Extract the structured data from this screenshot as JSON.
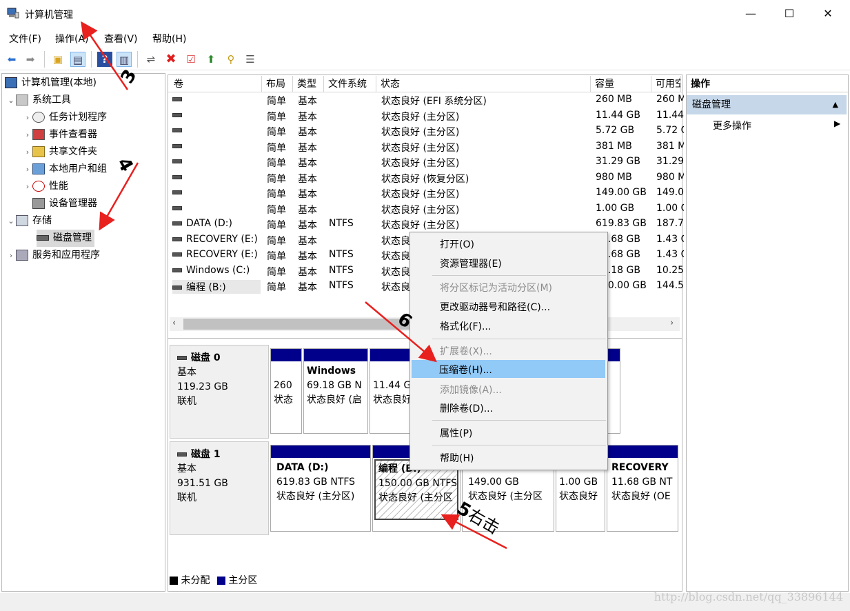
{
  "window": {
    "title": "计算机管理",
    "minimize": "—",
    "maximize": "☐",
    "close": "✕"
  },
  "menu": [
    "文件(F)",
    "操作(A)",
    "查看(V)",
    "帮助(H)"
  ],
  "toolbar_icons": [
    "back-icon",
    "forward-icon",
    "up-folder-icon",
    "show-hide-tree-icon",
    "help-icon",
    "console-icon",
    "connect-icon",
    "delete-icon",
    "check-icon",
    "export-icon",
    "search-icon",
    "properties-icon"
  ],
  "tree": {
    "root": "计算机管理(本地)",
    "system_tools": "系统工具",
    "task_scheduler": "任务计划程序",
    "event_viewer": "事件查看器",
    "shared_folders": "共享文件夹",
    "local_users": "本地用户和组",
    "performance": "性能",
    "device_manager": "设备管理器",
    "storage": "存储",
    "disk_management": "磁盘管理",
    "services": "服务和应用程序"
  },
  "table": {
    "headers": [
      "卷",
      "布局",
      "类型",
      "文件系统",
      "状态",
      "容量",
      "可用空"
    ],
    "rows": [
      [
        "",
        "简单",
        "基本",
        "",
        "状态良好 (EFI 系统分区)",
        "260 MB",
        "260 MB"
      ],
      [
        "",
        "简单",
        "基本",
        "",
        "状态良好 (主分区)",
        "11.44 GB",
        "11.44"
      ],
      [
        "",
        "简单",
        "基本",
        "",
        "状态良好 (主分区)",
        "5.72 GB",
        "5.72 G"
      ],
      [
        "",
        "简单",
        "基本",
        "",
        "状态良好 (主分区)",
        "381 MB",
        "381 M"
      ],
      [
        "",
        "简单",
        "基本",
        "",
        "状态良好 (主分区)",
        "31.29 GB",
        "31.29"
      ],
      [
        "",
        "简单",
        "基本",
        "",
        "状态良好 (恢复分区)",
        "980 MB",
        "980 M"
      ],
      [
        "",
        "简单",
        "基本",
        "",
        "状态良好 (主分区)",
        "149.00 GB",
        "149.0"
      ],
      [
        "",
        "简单",
        "基本",
        "",
        "状态良好 (主分区)",
        "1.00 GB",
        "1.00 G"
      ],
      [
        "DATA (D:)",
        "简单",
        "基本",
        "NTFS",
        "状态良好 (主分区)",
        "619.83 GB",
        "187.7"
      ],
      [
        "RECOVERY (E:)",
        "简单",
        "基本",
        "",
        "状态良",
        "11.68 GB",
        "1.43 G"
      ],
      [
        "RECOVERY (E:)",
        "简单",
        "基本",
        "NTFS",
        "状态良",
        "11.68 GB",
        "1.43 G"
      ],
      [
        "Windows (C:)",
        "简单",
        "基本",
        "NTFS",
        "状态良",
        "69.18 GB",
        "10.25"
      ],
      [
        "编程 (B:)",
        "简单",
        "基本",
        "NTFS",
        "状态良",
        "150.00 GB",
        "144.5"
      ]
    ]
  },
  "disks": {
    "disk0": {
      "name": "磁盘 0",
      "type": "基本",
      "size": "119.23 GB",
      "status": "联机",
      "parts": [
        {
          "l1": "",
          "l2": "260",
          "l3": "状态"
        },
        {
          "l1": "Windows",
          "l2": "69.18 GB N",
          "l3": "状态良好 (启"
        },
        {
          "l1": "",
          "l2": "11.44 G",
          "l3": "状态良好"
        }
      ]
    },
    "disk1": {
      "name": "磁盘 1",
      "type": "基本",
      "size": "931.51 GB",
      "status": "联机",
      "parts": [
        {
          "l1": "DATA  (D:)",
          "l2": "619.83 GB NTFS",
          "l3": "状态良好 (主分区)"
        },
        {
          "l1": "编程  (B:)",
          "l2": "150.00 GB NTFS",
          "l3": "状态良好 (主分区"
        },
        {
          "l1": "",
          "l2": "149.00 GB",
          "l3": "状态良好 (主分区"
        },
        {
          "l1": "",
          "l2": "1.00 GB",
          "l3": "状态良好"
        },
        {
          "l1": "RECOVERY",
          "l2": "11.68 GB NT",
          "l3": "状态良好 (OE"
        }
      ]
    }
  },
  "legend": {
    "unallocated": "未分配",
    "primary": "主分区"
  },
  "actions": {
    "header": "操作",
    "section": "磁盘管理",
    "more": "更多操作"
  },
  "context_menu": {
    "open": "打开(O)",
    "explorer": "资源管理器(E)",
    "mark_active": "将分区标记为活动分区(M)",
    "change_letter": "更改驱动器号和路径(C)...",
    "format": "格式化(F)...",
    "extend": "扩展卷(X)...",
    "shrink": "压缩卷(H)...",
    "mirror": "添加镜像(A)...",
    "delete": "删除卷(D)...",
    "properties": "属性(P)",
    "help": "帮助(H)"
  },
  "annotations": {
    "a3": "3",
    "a4": "4",
    "a5": "5",
    "a5_text": "右击",
    "a6": "6"
  },
  "watermark": "http://blog.csdn.net/qq_33896144",
  "colors": {
    "primary_partition": "#00008b",
    "highlight": "#91c9f7",
    "arrow": "#e8201e"
  }
}
